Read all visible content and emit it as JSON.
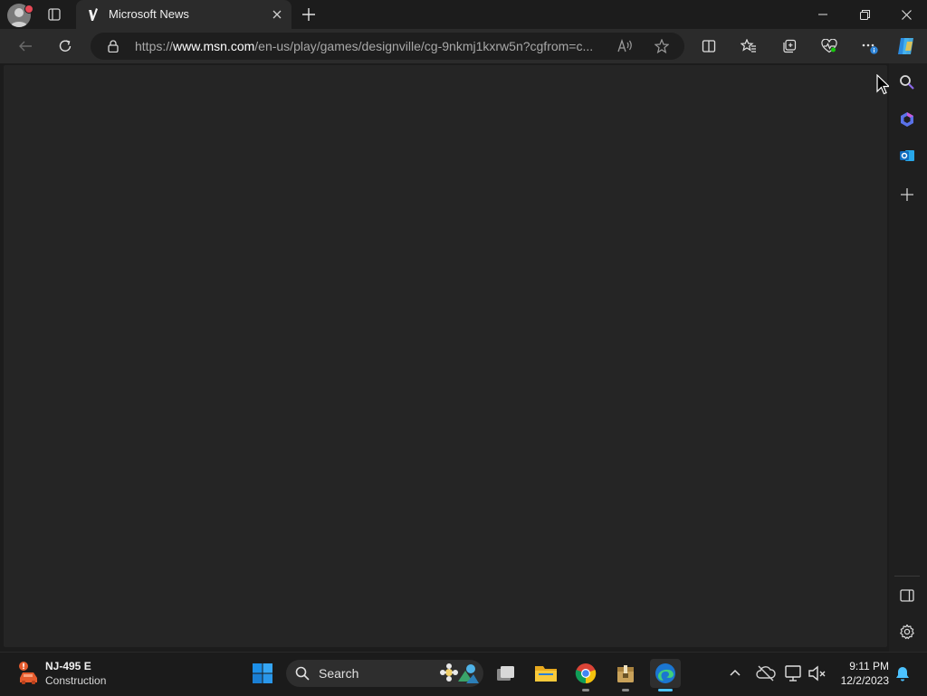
{
  "window": {
    "tab_title": "Microsoft News",
    "url_prefix": "https://",
    "url_domain": "www.msn.com",
    "url_rest": "/en-us/play/games/designville/cg-9nkmj1kxrw5n?cgfrom=c..."
  },
  "taskbar": {
    "weather_title": "NJ-495 E",
    "weather_subtitle": "Construction",
    "search_label": "Search",
    "time": "9:11 PM",
    "date": "12/2/2023"
  },
  "colors": {
    "accent": "#0078d4",
    "content_bg": "#252525",
    "toolbar_bg": "#2b2b2b",
    "taskbar_bg": "#1b1b1b"
  }
}
